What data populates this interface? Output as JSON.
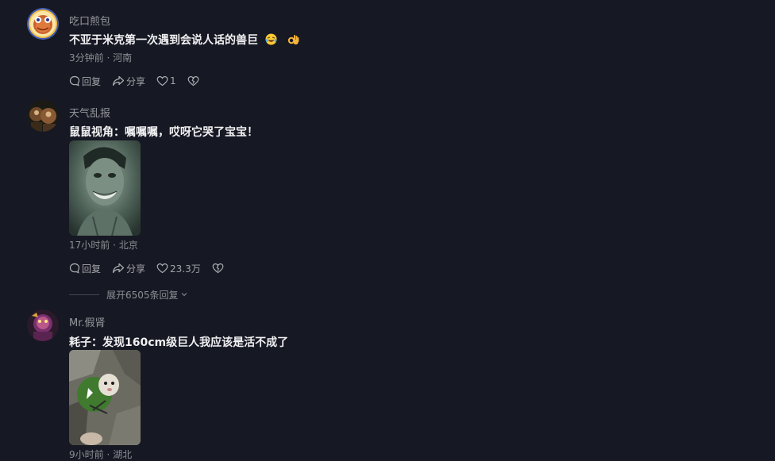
{
  "comments": [
    {
      "username": "吃口煎包",
      "text": "不亚于米克第一次遇到会说人话的兽巨",
      "emojis": [
        "rolling-laughing-emoji",
        "ok-hand-emoji"
      ],
      "meta": "3分钟前 · 河南",
      "reply_label": "回复",
      "share_label": "分享",
      "likes": "1"
    },
    {
      "username": "天气乱报",
      "text": "鼠鼠视角：嘱嘱嘱，哎呀它哭了宝宝！",
      "image": "grinning-green-giant-photo",
      "meta": "17小时前 · 北京",
      "reply_label": "回复",
      "share_label": "分享",
      "likes": "23.3万",
      "expand_label": "展开6505条回复"
    },
    {
      "username": "Mr.假肾",
      "text": "耗子：发现160cm级巨人我应该是活不成了",
      "image": "hamster-in-green-cloak-photo",
      "meta": "9小时前 · 湖北"
    }
  ],
  "colors": {
    "background": "#161823",
    "text": "#f1f1f3",
    "muted": "#8a8b91"
  }
}
